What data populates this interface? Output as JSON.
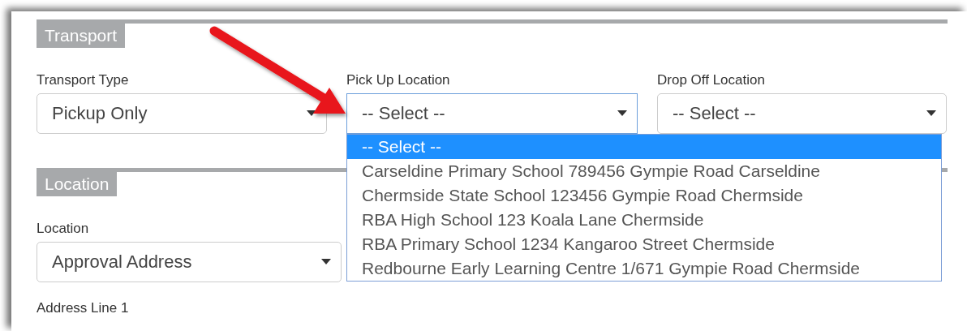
{
  "sections": [
    {
      "title": "Transport",
      "fields": [
        {
          "label": "Transport Type",
          "value": "Pickup Only",
          "kind": "select",
          "expanded": false
        },
        {
          "label": "Pick Up Location",
          "value": "-- Select --",
          "kind": "select",
          "expanded": true,
          "options": [
            {
              "text": "-- Select --",
              "selected": true
            },
            {
              "text": "Carseldine Primary School 789456 Gympie Road Carseldine",
              "selected": false
            },
            {
              "text": "Chermside State School 123456 Gympie Road Chermside",
              "selected": false
            },
            {
              "text": "RBA High School 123 Koala Lane Chermside",
              "selected": false
            },
            {
              "text": "RBA Primary School 1234 Kangaroo Street Chermside",
              "selected": false
            },
            {
              "text": "Redbourne Early Learning Centre 1/671 Gympie Road Chermside",
              "selected": false
            }
          ]
        },
        {
          "label": "Drop Off Location",
          "value": "-- Select --",
          "kind": "select",
          "expanded": false
        }
      ]
    },
    {
      "title": "Location",
      "fields": [
        {
          "label": "Location",
          "value": "Approval Address",
          "kind": "select",
          "expanded": false
        },
        {
          "label": "Address Line 1",
          "kind": "label"
        }
      ]
    }
  ]
}
